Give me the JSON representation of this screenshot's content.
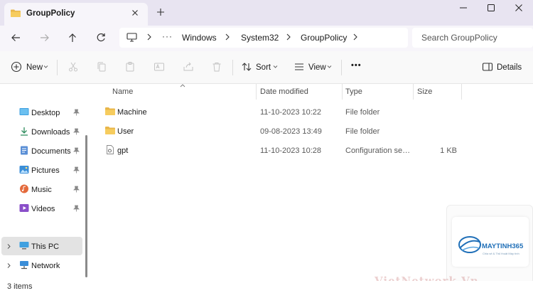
{
  "window": {
    "tab_title": "GroupPolicy",
    "icons": {
      "tab": "folder-icon",
      "close": "close-icon",
      "new_tab": "plus-icon",
      "min": "minimize-icon",
      "max": "maximize-icon",
      "win_close": "close-icon"
    }
  },
  "address": {
    "more_path": "···",
    "breadcrumbs": [
      "Windows",
      "System32",
      "GroupPolicy"
    ],
    "search_placeholder": "Search GroupPolicy"
  },
  "toolbar": {
    "new_label": "New",
    "sort_label": "Sort",
    "view_label": "View",
    "more_label": "•••",
    "details_label": "Details",
    "disabled_icons": [
      "cut-icon",
      "copy-icon",
      "paste-icon",
      "rename-icon",
      "share-icon",
      "delete-icon"
    ]
  },
  "sidebar": {
    "items": [
      {
        "label": "Desktop",
        "icon": "desktop-icon",
        "pinned": true
      },
      {
        "label": "Downloads",
        "icon": "download-icon",
        "pinned": true
      },
      {
        "label": "Documents",
        "icon": "documents-icon",
        "pinned": true
      },
      {
        "label": "Pictures",
        "icon": "pictures-icon",
        "pinned": true
      },
      {
        "label": "Music",
        "icon": "music-icon",
        "pinned": true
      },
      {
        "label": "Videos",
        "icon": "videos-icon",
        "pinned": true
      }
    ],
    "this_pc": "This PC",
    "network": "Network"
  },
  "columns": {
    "name": "Name",
    "date": "Date modified",
    "type": "Type",
    "size": "Size"
  },
  "files": [
    {
      "name": "Machine",
      "date": "11-10-2023 10:22",
      "type": "File folder",
      "size": "",
      "icon": "folder-icon"
    },
    {
      "name": "User",
      "date": "09-08-2023 13:49",
      "type": "File folder",
      "size": "",
      "icon": "folder-icon"
    },
    {
      "name": "gpt",
      "date": "11-10-2023 10:28",
      "type": "Configuration settings",
      "size": "1 KB",
      "icon": "config-file-icon"
    }
  ],
  "status": {
    "item_count": "3 items"
  },
  "watermark": {
    "brand": "MAYTINH365",
    "tagline": "Chia sẻ & Thủ thuật Máy tính",
    "site": "VietNetwork.Vn"
  },
  "colors": {
    "titlebar": "#e8e4f1",
    "folder": "#f2c94c",
    "accent": "#1f6fb8"
  }
}
